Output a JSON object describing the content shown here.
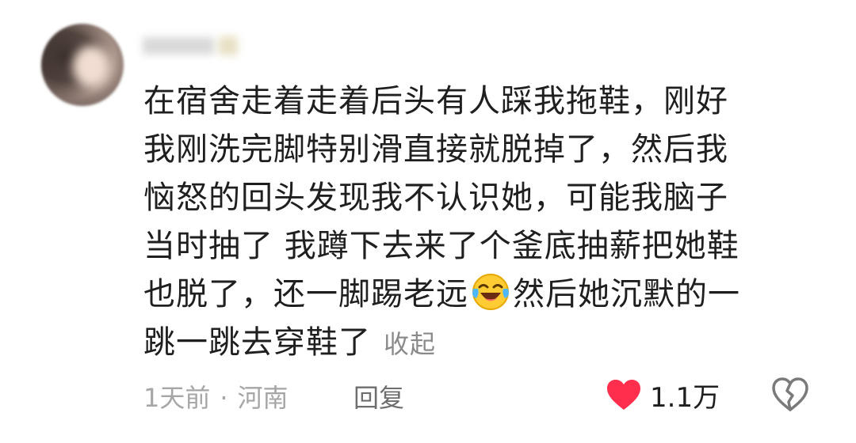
{
  "comment": {
    "avatar_icon": "user-avatar-blurred",
    "username": "",
    "lines": [
      "在宿舍走着走着后头有人踩我拖鞋，刚好",
      "我刚洗完脚特别滑直接就脱掉了，然后我",
      "恼怒的回头发现我不认识她，可能我脑子",
      "当时抽了 我蹲下去来了个釜底抽薪把她鞋"
    ],
    "line5_before_emoji": "也脱了，还一脚踢老远",
    "emoji_icon": "laughing-tears-emoji-icon",
    "line5_after_emoji": "然后她沉默的一",
    "line6": "跳一跳去穿鞋了",
    "collapse_label": "收起"
  },
  "meta": {
    "time": "1天前",
    "separator": "·",
    "location": "河南",
    "reply_label": "回复"
  },
  "like": {
    "icon": "heart-filled-icon",
    "count": "1.1万",
    "color": "#ff2e4d"
  },
  "dislike": {
    "icon": "broken-heart-icon"
  }
}
